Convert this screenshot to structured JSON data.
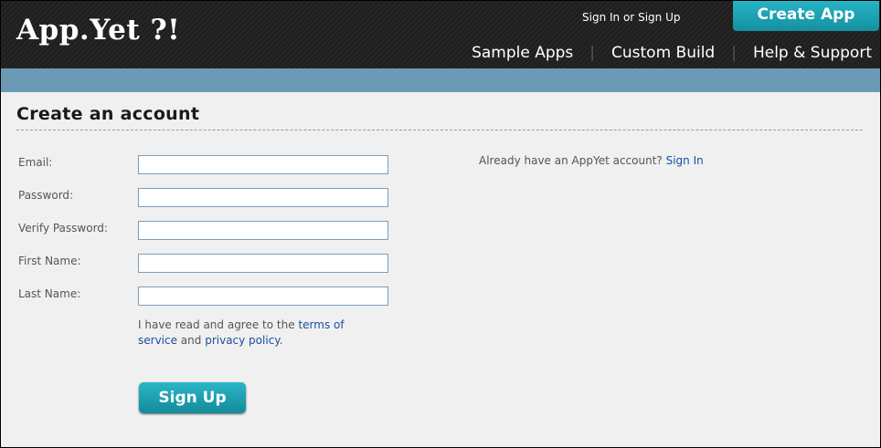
{
  "header": {
    "logo": "App.Yet ?!",
    "signin_text": "Sign In",
    "or_text": "or",
    "signup_text": "Sign Up",
    "create_app_label": "Create App",
    "nav": [
      "Sample Apps",
      "Custom Build",
      "Help & Support"
    ],
    "nav_separator": "|"
  },
  "main": {
    "title": "Create an account",
    "form": {
      "email_label": "Email:",
      "password_label": "Password:",
      "verify_password_label": "Verify Password:",
      "first_name_label": "First Name:",
      "last_name_label": "Last Name:"
    },
    "terms": {
      "prefix": "I have read and agree to the ",
      "terms_link": "terms of service",
      "middle": " and ",
      "privacy_link": "privacy policy",
      "suffix": "."
    },
    "signup_button": "Sign Up",
    "already": {
      "text": "Already have an AppYet account? ",
      "link": "Sign In"
    }
  },
  "colors": {
    "accent": "#1ca2b2",
    "header_bg": "#222222",
    "bar": "#6c9ab6",
    "link": "#1a4fa0"
  }
}
